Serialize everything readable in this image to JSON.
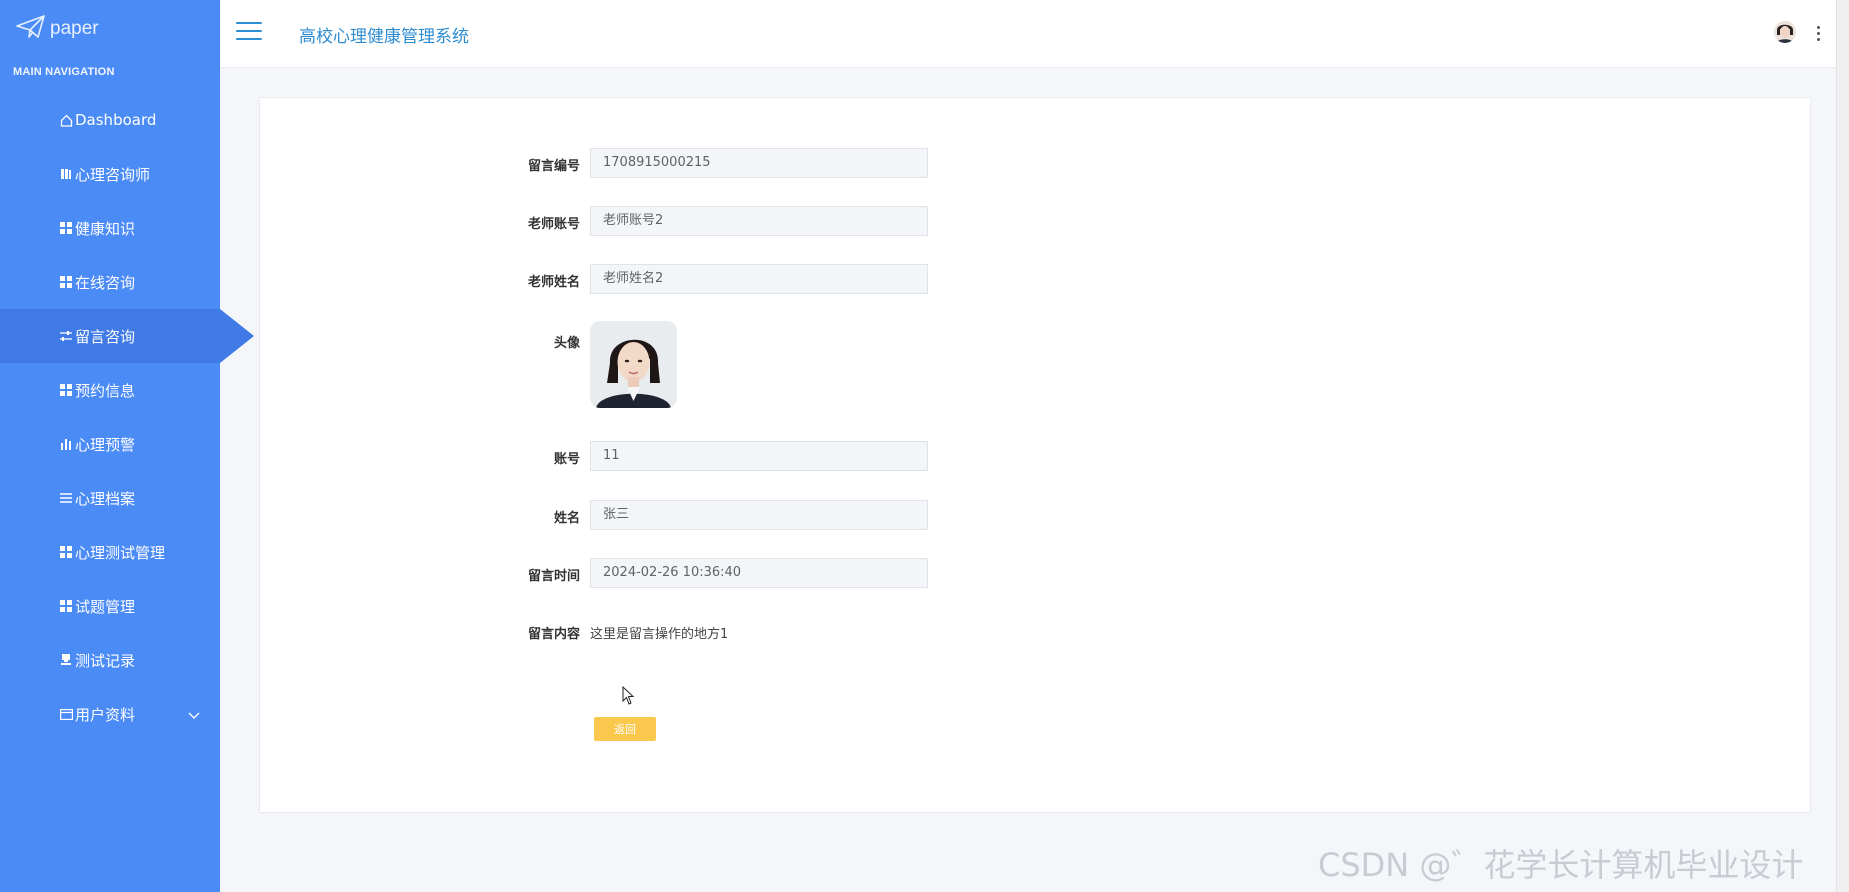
{
  "brand": {
    "logo_text": "paper",
    "icon": "paper-plane-icon"
  },
  "sidebar": {
    "header": "MAIN NAVIGATION",
    "items": [
      {
        "label": "Dashboard",
        "icon": "home-icon"
      },
      {
        "label": "心理咨询师",
        "icon": "book-icon"
      },
      {
        "label": "健康知识",
        "icon": "grid-icon"
      },
      {
        "label": "在线咨询",
        "icon": "grid-icon"
      },
      {
        "label": "留言咨询",
        "icon": "sliders-icon",
        "active": true
      },
      {
        "label": "预约信息",
        "icon": "grid-icon"
      },
      {
        "label": "心理预警",
        "icon": "bar-chart-icon"
      },
      {
        "label": "心理档案",
        "icon": "list-icon"
      },
      {
        "label": "心理测试管理",
        "icon": "grid-icon"
      },
      {
        "label": "试题管理",
        "icon": "grid-icon"
      },
      {
        "label": "测试记录",
        "icon": "stamp-icon"
      },
      {
        "label": "用户资料",
        "icon": "id-card-icon",
        "has_submenu": true
      }
    ]
  },
  "header": {
    "title": "高校心理健康管理系统"
  },
  "form": {
    "message_id": {
      "label": "留言编号",
      "value": "1708915000215"
    },
    "teacher_account": {
      "label": "老师账号",
      "value": "老师账号2"
    },
    "teacher_name": {
      "label": "老师姓名",
      "value": "老师姓名2"
    },
    "avatar": {
      "label": "头像"
    },
    "account": {
      "label": "账号",
      "value": "11"
    },
    "name": {
      "label": "姓名",
      "value": "张三"
    },
    "message_time": {
      "label": "留言时间",
      "value": "2024-02-26 10:36:40"
    },
    "message_content": {
      "label": "留言内容",
      "value": "这里是留言操作的地方1"
    },
    "back_button": "返回"
  },
  "watermark": "CSDN @゛花学长计算机毕业设计",
  "colors": {
    "sidebar": "#4b8bf6",
    "sidebar_active": "#3f7ae6",
    "title": "#2e8bd0",
    "button": "#f9c84c"
  }
}
